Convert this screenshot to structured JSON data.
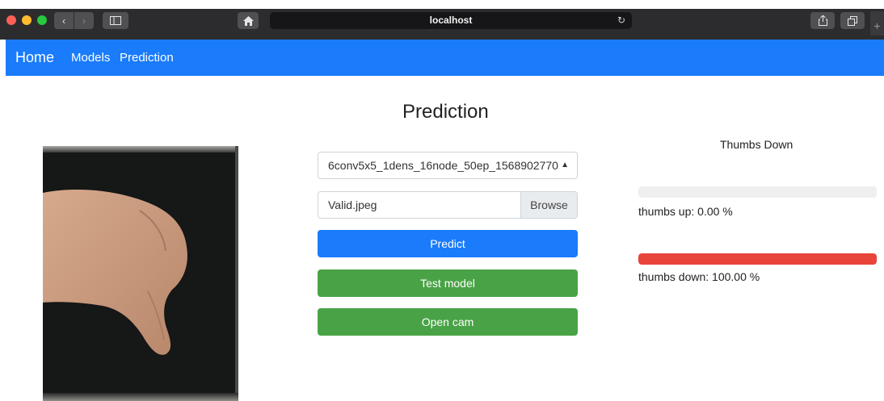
{
  "browser": {
    "address": "localhost",
    "icons": [
      "back-icon",
      "forward-icon",
      "sidebar-icon",
      "home-icon",
      "reload-icon",
      "share-icon",
      "tabs-icon",
      "new-tab-icon"
    ]
  },
  "navbar": {
    "brand": "Home",
    "links": [
      "Models",
      "Prediction"
    ],
    "color": "#1a7bfb"
  },
  "main": {
    "title": "Prediction",
    "model_select": "6conv5x5_1dens_16node_50ep_1568902770",
    "file_name": "Valid.jpeg",
    "browse_label": "Browse",
    "buttons": {
      "predict": "Predict",
      "test": "Test model",
      "cam": "Open cam"
    }
  },
  "result": {
    "title": "Thumbs Down",
    "up_label": "thumbs up: 0.00 %",
    "up_value": 0.0,
    "down_label": "thumbs down: 100.00 %",
    "down_value": 100.0,
    "bar_color": "#e8443a"
  },
  "colors": {
    "primary": "#1a7bfb",
    "success": "#49a346",
    "danger": "#e8443a"
  }
}
